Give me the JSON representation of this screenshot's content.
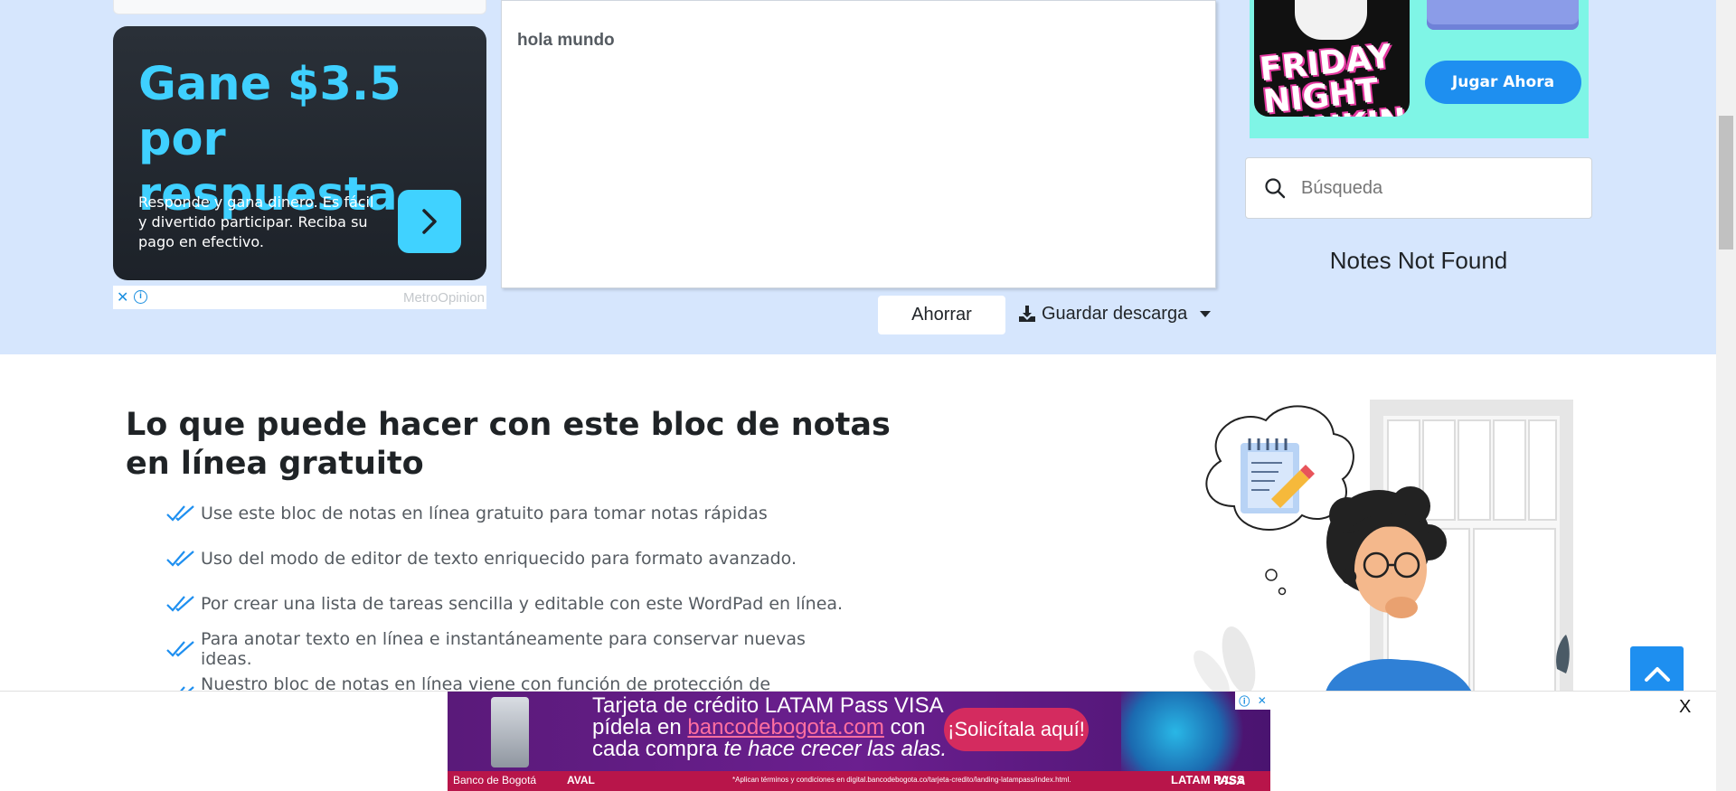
{
  "editor": {
    "content": "hola mundo"
  },
  "actions": {
    "save_label": "Ahorrar",
    "download_label": "Guardar descarga"
  },
  "search": {
    "placeholder": "Búsqueda"
  },
  "notes_status": "Notes Not Found",
  "ad_left": {
    "headline": "Gane $3.5 por respuesta",
    "body": "Responde y gana dinero. Es fácil y divertido participar. Reciba su pago en efectivo.",
    "brand": "MetroOpinion",
    "accent": "#3fd0ff"
  },
  "game_ad": {
    "logo_text": "FRIDAY NIGHT FUNKIN",
    "play_label": "Jugar Ahora",
    "bg": "#7ff5e6"
  },
  "features": {
    "title": "Lo que puede hacer con este bloc de notas en línea gratuito",
    "items": [
      "Use este bloc de notas en línea gratuito para tomar notas rápidas",
      "Uso del modo de editor de texto enriquecido para formato avanzado.",
      "Por crear una lista de tareas sencilla y editable con este WordPad en línea.",
      "Para anotar texto en línea e instantáneamente para conservar nuevas ideas.",
      "Nuestro bloc de notas en línea viene con función de protección de contraseña"
    ]
  },
  "bottom_ad": {
    "line1": "Tarjeta de crédito LATAM Pass VISA",
    "line2_prefix": "pídela en ",
    "line2_link": "bancodebogota.com",
    "line2_suffix": " con",
    "line3_prefix": "cada compra ",
    "line3_em": "te hace crecer las alas.",
    "cta": "¡Solicítala aquí!",
    "bank": "Banco de Bogotá",
    "aval": "AVAL",
    "fine_print": "*Aplican términos y condiciones en digital.bancodebogota.co/tarjeta-credito/landing-latampass/index.html.",
    "latam": "LATAM PASS",
    "visa": "VISA",
    "close": "X"
  },
  "colors": {
    "band": "#d6e6fd",
    "primary": "#1e8ff0",
    "check": "#1e8ff0"
  }
}
